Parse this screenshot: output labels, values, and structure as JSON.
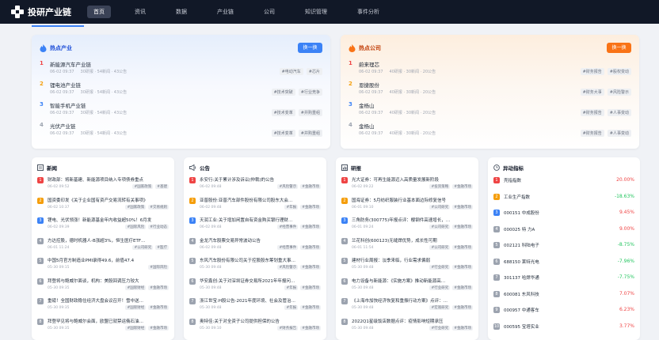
{
  "app": {
    "title": "投研产业链"
  },
  "nav": [
    "首页",
    "资讯",
    "数据",
    "产业链",
    "公司",
    "知识管理",
    "事件分析"
  ],
  "colors": {
    "accent": "#3b82f6",
    "orange": "#f97316",
    "up": "#ef4444",
    "down": "#22c55e",
    "rank1": "#ef4444",
    "rank2": "#f59e0b",
    "rank3": "#3b82f6",
    "rank_other": "#9ca3af"
  },
  "hot_industry": {
    "title": "热点产业",
    "swap": "换一换",
    "items": [
      {
        "rank": "1",
        "name": "新能源汽车产业链",
        "date": "06-02 09:37",
        "stats": "30研报 · 54新闻 · 43公告",
        "tags": [
          "#电动汽车",
          "#芯片"
        ]
      },
      {
        "rank": "2",
        "name": "锂电池产业链",
        "date": "06-02 09:37",
        "stats": "30研报 · 54新闻 · 43公告",
        "tags": [
          "#技术突破",
          "#行业竞争"
        ]
      },
      {
        "rank": "3",
        "name": "智能手机产业链",
        "date": "06-02 09:37",
        "stats": "30研报 · 54新闻 · 43公告",
        "tags": [
          "#技术变革",
          "#并购重组"
        ]
      },
      {
        "rank": "4",
        "name": "光伏产业链",
        "date": "06-02 09:37",
        "stats": "30研报 · 54新闻 · 43公告",
        "tags": [
          "#技术变革",
          "#并购重组"
        ]
      }
    ]
  },
  "hot_company": {
    "title": "热点公司",
    "swap": "换一换",
    "items": [
      {
        "rank": "1",
        "name": "蔚来理芯",
        "date": "06-02 09:37",
        "stats": "40研报 · 30新闻 · 20公告",
        "tags": [
          "#财务报告",
          "#股权变动"
        ]
      },
      {
        "rank": "2",
        "name": "恩捷股份",
        "date": "06-02 09:37",
        "stats": "40研报 · 30新闻 · 20公告",
        "tags": [
          "#财务大事",
          "#风险警示"
        ]
      },
      {
        "rank": "3",
        "name": "金杨山",
        "date": "06-02 09:37",
        "stats": "40研报 · 30新闻 · 20公告",
        "tags": [
          "#财务报告",
          "#人事变动"
        ]
      },
      {
        "rank": "4",
        "name": "金杨山",
        "date": "06-02 09:37",
        "stats": "40研报 · 30新闻 · 20公告",
        "tags": [
          "#财务报告",
          "#人事变动"
        ]
      }
    ]
  },
  "news": {
    "title": "新闻",
    "items": [
      {
        "n": "1",
        "title": "财政部：将新基建、新能源项目纳入专项债券重点",
        "date": "06-02 09:52",
        "tags": [
          "#国家政策",
          "#基建"
        ]
      },
      {
        "n": "2",
        "title": "国资委印发《关于企业国有资产交易流转有关事项》",
        "date": "06-02 10:37",
        "tags": [
          "#国家政策",
          "#交易规则"
        ]
      },
      {
        "n": "3",
        "title": "锂电、光伏领涨！新能源基金年内收益超50%！6月发",
        "date": "06-02 09:39",
        "tags": [
          "#国际风险",
          "#行业动态"
        ]
      },
      {
        "n": "4",
        "title": "方达控股，德时机器人-B涨超3%，恒生医疗ETF…",
        "date": "06-01 11:24",
        "tags": [
          "#公司研究",
          "#医疗"
        ]
      },
      {
        "n": "5",
        "title": "中国5月官方制造业PMI录得49.6，前值47.4",
        "date": "05-30 09:15",
        "tags": [
          "#国际风险"
        ]
      },
      {
        "n": "6",
        "title": "拜登将与鲍威尔面谈，机构：美股回调压力较大",
        "date": "05-30 09:35",
        "tags": [
          "#国际财经",
          "#金融市场"
        ]
      },
      {
        "n": "7",
        "title": "重磅！全国财政稳住经济大盘会议召开！雪中送…",
        "date": "05-30 09:35",
        "tags": [
          "#国际财经",
          "#金融市场"
        ]
      },
      {
        "n": "8",
        "title": "拜登罕见将与鲍威尔会面，欧盟已就禁运俄石油…",
        "date": "05-30 09:35",
        "tags": [
          "#国际财经",
          "#金融市场"
        ]
      }
    ]
  },
  "announcements": {
    "title": "公告",
    "items": [
      {
        "n": "1",
        "title": "永安行:关于累计涉及诉讼(仲裁)的公告",
        "date": "06-02 09:48",
        "tags": [
          "#风险警示",
          "#金融市场"
        ]
      },
      {
        "n": "2",
        "title": "亚普股份:亚普汽车部件股份有限公司股东大会…",
        "date": "06-02 09:48",
        "tags": [
          "#年报",
          "#金融市场"
        ]
      },
      {
        "n": "3",
        "title": "天润工业:关于增加闲置自有资金购买银行理财…",
        "date": "06-02 09:48",
        "tags": [
          "#经营事件",
          "#金融市场"
        ]
      },
      {
        "n": "4",
        "title": "金龙汽车股票交易异常波动公告",
        "date": "06-02 09:48",
        "tags": [
          "#经营事件",
          "#金融市场"
        ]
      },
      {
        "n": "5",
        "title": "东风汽车股份有限公司关于控股股东筹划重大事…",
        "date": "05-30 09:48",
        "tags": [
          "#风险警示",
          "#金融市场"
        ]
      },
      {
        "n": "6",
        "title": "华安鑫创:关于对深圳证券交易所2021年年报问…",
        "date": "05-30 09:48",
        "tags": [
          "#年报",
          "#金融市场"
        ]
      },
      {
        "n": "7",
        "title": "浙江世宝:H股公告-2021年度环境、社会及管治…",
        "date": "05-30 09:48",
        "tags": [
          "#年报",
          "#金融市场"
        ]
      },
      {
        "n": "8",
        "title": "奥特佳:关于对全资子公司提供担保的公告",
        "date": "05-30 09:10",
        "tags": [
          "#财务报告",
          "#金融市场"
        ]
      }
    ]
  },
  "research": {
    "title": "研报",
    "items": [
      {
        "n": "1",
        "title": "光大证券：可再生能源迈入高质量发展新阶段",
        "date": "06-02 09:22",
        "tags": [
          "#投资策略",
          "#金融市场"
        ]
      },
      {
        "n": "2",
        "title": "国海证券：5月纺织服装行业基本面边际修复信号",
        "date": "06-01 09:10",
        "tags": [
          "#公司研究",
          "#金融市场"
        ]
      },
      {
        "n": "3",
        "title": "三角防务(300775)年报点评：樱钢件高速增长，…",
        "date": "06-01 09:24",
        "tags": [
          "#公司研究",
          "#金融市场"
        ]
      },
      {
        "n": "4",
        "title": "兰花科创(600123)无缝焊优势，成长性可期",
        "date": "06-01 11:54",
        "tags": [
          "#公司研究",
          "#金融市场"
        ]
      },
      {
        "n": "5",
        "title": "建材行业周报：淡季来临，行业需求偏弱",
        "date": "05-30 09:48",
        "tags": [
          "#行业研究",
          "#金融市场"
        ]
      },
      {
        "n": "6",
        "title": "电力设备与新能源：《实施方案》推动新能源高…",
        "date": "05-30 09:48",
        "tags": [
          "#行业研究",
          "#金融市场"
        ]
      },
      {
        "n": "7",
        "title": "《上海市加快经济恢复和重振行动方案》点评：…",
        "date": "05-30 09:48",
        "tags": [
          "#宏观研究",
          "#金融市场"
        ]
      },
      {
        "n": "8",
        "title": "2022Q1星级饭店数据点评：疫情影响短期承压",
        "date": "05-30 09:48",
        "tags": [
          "#行业研究",
          "#金融市场"
        ]
      }
    ]
  },
  "movers": {
    "title": "异动指标",
    "items": [
      {
        "n": "1",
        "name": "壳指指数",
        "value": "20.00%",
        "dir": "up"
      },
      {
        "n": "2",
        "name": "工业生产指数",
        "value": "-18.63%",
        "dir": "down"
      },
      {
        "n": "3",
        "name": "000151 中成股份",
        "value": "9.45%",
        "dir": "up"
      },
      {
        "n": "4",
        "name": "000025 特 力A",
        "value": "9.00%",
        "dir": "up"
      },
      {
        "n": "5",
        "name": "002121 科陆电子",
        "value": "-8.75%",
        "dir": "down"
      },
      {
        "n": "6",
        "name": "688150 莱特光电",
        "value": "-7.96%",
        "dir": "down"
      },
      {
        "n": "7",
        "name": "301137 哈焊华通",
        "value": "-7.75%",
        "dir": "down"
      },
      {
        "n": "8",
        "name": "600081 东风科技",
        "value": "7.07%",
        "dir": "up"
      },
      {
        "n": "9",
        "name": "000957 中通客车",
        "value": "6.23%",
        "dir": "up"
      },
      {
        "n": "10",
        "name": "000595 宝塔实业",
        "value": "3.77%",
        "dir": "up"
      }
    ]
  }
}
